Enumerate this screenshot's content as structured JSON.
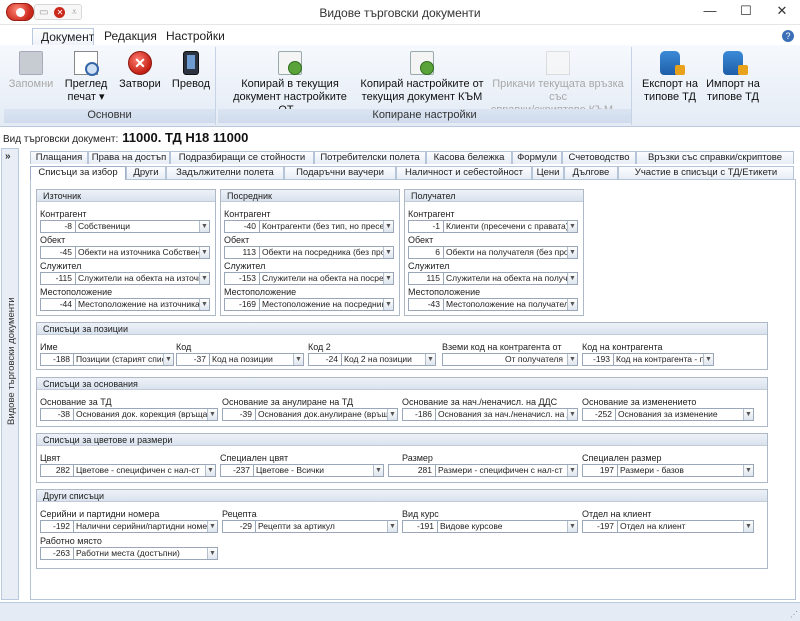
{
  "window": {
    "title": "Видове търговски документи",
    "buttons": {
      "minimize": "—",
      "maximize": "☐",
      "close": "✕"
    }
  },
  "ribbon_tabs": [
    "Документ",
    "Редакция",
    "Настройки"
  ],
  "active_ribbon_tab": "Документ",
  "ribbon": {
    "groups": [
      {
        "label": "Основни"
      },
      {
        "label": "Копиране настройки"
      }
    ],
    "buttons": {
      "save": {
        "label": "Запомни",
        "icon": "floppy-icon",
        "enabled": false
      },
      "preview": {
        "label1": "Преглед",
        "label2": "печат ▾",
        "icon": "print-preview-icon"
      },
      "close": {
        "label": "Затвори",
        "icon": "close-icon"
      },
      "go": {
        "label": "Превод",
        "icon": "device-icon"
      },
      "copy_to": {
        "label1": "Копирай в текущия",
        "label2": "документ настройките ОТ...",
        "icon": "copy-icon"
      },
      "copy_from": {
        "label1": "Копирай настройките от",
        "label2": "текущия документ КЪМ",
        "icon": "copy-icon"
      },
      "attach": {
        "label1": "Прикачи текущата връзка със",
        "label2": "справки/скриптове КЪМ ...",
        "icon": "attach-icon",
        "enabled": false
      },
      "export": {
        "label1": "Експорт на",
        "label2": "типове ТД",
        "icon": "database-export-icon"
      },
      "import": {
        "label1": "Импорт на",
        "label2": "типове ТД",
        "icon": "database-import-icon"
      }
    }
  },
  "doc_type": {
    "label": "Вид търговски документ:",
    "value": "11000. ТД Н18 11000"
  },
  "side_panel": {
    "label": "Видове търговски документи",
    "toggle": "»"
  },
  "tabs_row1": [
    "Плащания",
    "Права на достъп",
    "Подразбиращи се стойности",
    "Потребителски полета",
    "Касова бележка",
    "Формули",
    "Счетоводство",
    "Връзки със справки/скриптове"
  ],
  "tabs_row2": [
    "Списъци за избор",
    "Други",
    "Задължителни полета",
    "Подаръчни ваучери",
    "Наличност и себестойност",
    "Цени",
    "Дългове",
    "Участие в списъци с ТД/Етикети"
  ],
  "active_tab": "Списъци за избор",
  "source": {
    "title": "Източник",
    "rows": [
      {
        "label": "Контрагент",
        "num": "-8",
        "value": "Собственици"
      },
      {
        "label": "Обект",
        "num": "-45",
        "value": "Обекти на източника Собственик (с"
      },
      {
        "label": "Служител",
        "num": "-115",
        "value": "Служители на обекта на източника"
      },
      {
        "label": "Местоположение",
        "num": "-44",
        "value": "Местоположение на източника"
      }
    ]
  },
  "intermediary": {
    "title": "Посредник",
    "rows": [
      {
        "label": "Контрагент",
        "num": "-40",
        "value": "Контрагенти (без тип, но пресечени"
      },
      {
        "label": "Обект",
        "num": "113",
        "value": "Обекти на посредника (без пров.пр"
      },
      {
        "label": "Служител",
        "num": "-153",
        "value": "Служители на обекта на посредник"
      },
      {
        "label": "Местоположение",
        "num": "-169",
        "value": "Местоположение на посредника"
      }
    ]
  },
  "recipient": {
    "title": "Получател",
    "rows": [
      {
        "label": "Контрагент",
        "num": "-1",
        "value": "Клиенти (пресечени с правата)"
      },
      {
        "label": "Обект",
        "num": "6",
        "value": "Обекти на получателя (без пров.пр"
      },
      {
        "label": "Служител",
        "num": "115",
        "value": "Служители на обекта на получател"
      },
      {
        "label": "Местоположение",
        "num": "-43",
        "value": "Местоположение на получателя"
      }
    ]
  },
  "positions": {
    "title": "Списъци за позиции",
    "fields": [
      {
        "label": "Име",
        "num": "-188",
        "value": "Позиции (старият списък б"
      },
      {
        "label": "Код",
        "num": "-37",
        "value": "Код на позиции"
      },
      {
        "label": "Код 2",
        "num": "-24",
        "value": "Код 2 на позиции"
      },
      {
        "label": "Вземи код на контрагента от",
        "value": "От получателя"
      },
      {
        "label": "Код на контрагента",
        "num": "-193",
        "value": "Код на контрагента - по"
      }
    ]
  },
  "reasons": {
    "title": "Списъци за основания",
    "fields": [
      {
        "label": "Основание за ТД",
        "num": "-38",
        "value": "Основания док. корекция (връща ID!)"
      },
      {
        "label": "Основание за анулиране на ТД",
        "num": "-39",
        "value": "Основания док.анулиране (връща ID!)"
      },
      {
        "label": "Основание за нач./неначисл. на ДДС",
        "num": "-186",
        "value": "Основания за нач./неначисл. на ДДС (Пр"
      },
      {
        "label": "Основание за изменението",
        "num": "-252",
        "value": "Основания за изменение"
      }
    ]
  },
  "colors_sizes": {
    "title": "Списъци за цветове и размери",
    "fields": [
      {
        "label": "Цвят",
        "num": "282",
        "value": "Цветове - специфичен с нал-ст"
      },
      {
        "label": "Специален цвят",
        "num": "-237",
        "value": "Цветове - Всички"
      },
      {
        "label": "Размер",
        "num": "281",
        "value": "Размери - специфичен с нал-ст"
      },
      {
        "label": "Специален размер",
        "num": "197",
        "value": "Размери - базов"
      }
    ]
  },
  "other": {
    "title": "Други списъци",
    "fields": [
      {
        "label": "Серийни и партидни номера",
        "num": "-192",
        "value": "Налични серийни/партидни номера с р"
      },
      {
        "label": "Рецепта",
        "num": "-29",
        "value": "Рецепти за артикул"
      },
      {
        "label": "Вид курс",
        "num": "-191",
        "value": "Видове курсове"
      },
      {
        "label": "Отдел на клиент",
        "num": "-197",
        "value": "Отдел на клиент"
      },
      {
        "label": "Работно място",
        "num": "-263",
        "value": "Работни места (достъпни)"
      }
    ]
  }
}
